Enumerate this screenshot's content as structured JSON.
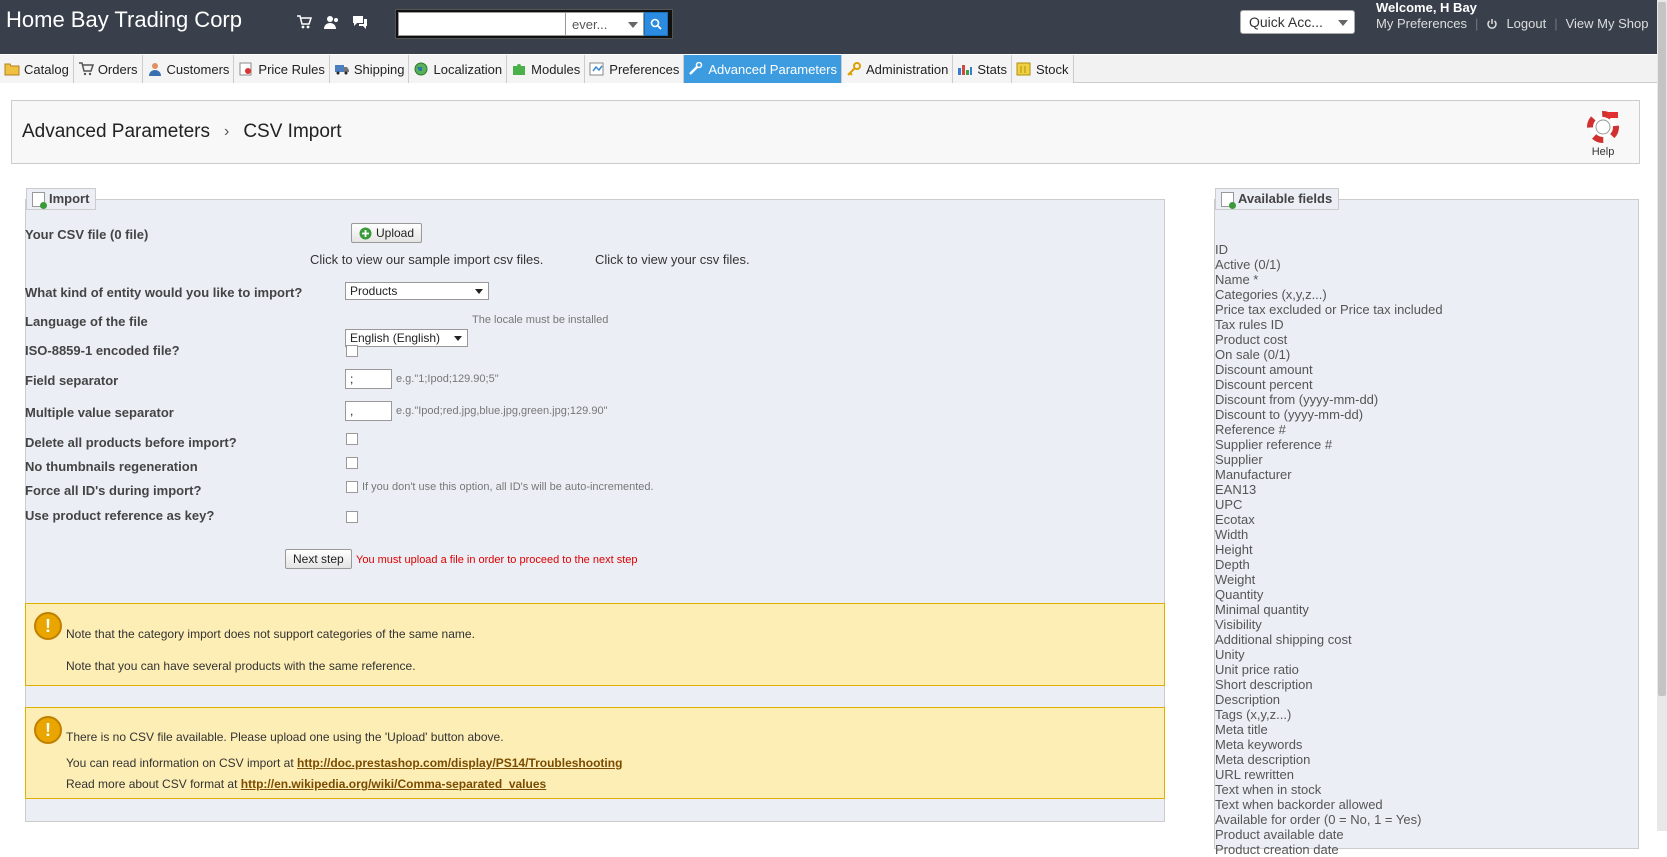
{
  "header": {
    "shop_title": "Home Bay Trading Corp",
    "search_value": "",
    "search_scope": "ever...",
    "quick_access": "Quick Acc...",
    "welcome": "Welcome, H Bay",
    "links": [
      "My Preferences",
      "Logout",
      "View My Shop"
    ]
  },
  "tabs": [
    {
      "label": "Catalog",
      "icon": "folder-icon"
    },
    {
      "label": "Orders",
      "icon": "cart-icon"
    },
    {
      "label": "Customers",
      "icon": "user-icon"
    },
    {
      "label": "Price Rules",
      "icon": "price-tag-icon"
    },
    {
      "label": "Shipping",
      "icon": "truck-icon"
    },
    {
      "label": "Localization",
      "icon": "globe-icon"
    },
    {
      "label": "Modules",
      "icon": "puzzle-icon"
    },
    {
      "label": "Preferences",
      "icon": "preferences-icon"
    },
    {
      "label": "Advanced Parameters",
      "icon": "tools-icon",
      "active": true
    },
    {
      "label": "Administration",
      "icon": "key-icon"
    },
    {
      "label": "Stats",
      "icon": "chart-icon"
    },
    {
      "label": "Stock",
      "icon": "stock-icon"
    }
  ],
  "breadcrumb": [
    "Advanced Parameters",
    "CSV Import"
  ],
  "help_label": "Help",
  "import": {
    "legend": "Import",
    "csv_file_label": "Your CSV file (0 file)",
    "upload_label": "Upload",
    "sample_link": "Click to view our sample import csv files.",
    "your_files_link": "Click to view your csv files.",
    "entity_label": "What kind of entity would you like to import?",
    "entity_value": "Products",
    "language_label": "Language of the file",
    "language_value": "English (English)",
    "language_hint": "The locale must be installed",
    "iso_label": "ISO-8859-1 encoded file?",
    "field_sep_label": "Field separator",
    "field_sep_value": ";",
    "field_sep_hint": "e.g.\"1;Ipod;129.90;5\"",
    "multi_sep_label": "Multiple value separator",
    "multi_sep_value": ",",
    "multi_sep_hint": "e.g.\"Ipod;red.jpg,blue.jpg,green.jpg;129.90\"",
    "delete_label": "Delete all products before import?",
    "thumbs_label": "No thumbnails regeneration",
    "force_ids_label": "Force all ID's during import?",
    "force_ids_hint": "If you don't use this option, all ID's will be auto-incremented.",
    "ref_key_label": "Use product reference as key?",
    "next_label": "Next step",
    "next_warning": "You must upload a file in order to proceed to the next step"
  },
  "notes": {
    "n1_line1": "Note that the category import does not support categories of the same name.",
    "n1_line2": "Note that you can have several products with the same reference.",
    "n2_line1": "There is no CSV file available. Please upload one using the 'Upload' button above.",
    "n2_line2_prefix": "You can read information on CSV import at",
    "n2_line2_link": "http://doc.prestashop.com/display/PS14/Troubleshooting",
    "n2_line3_prefix": "Read more about CSV format at",
    "n2_line3_link": "http://en.wikipedia.org/wiki/Comma-separated_values"
  },
  "available": {
    "legend": "Available fields",
    "fields": [
      "ID",
      "Active (0/1)",
      "Name *",
      "Categories (x,y,z...)",
      "Price tax excluded or Price tax included",
      "Tax rules ID",
      "Product cost",
      "On sale (0/1)",
      "Discount amount",
      "Discount percent",
      "Discount from (yyyy-mm-dd)",
      "Discount to (yyyy-mm-dd)",
      "Reference #",
      "Supplier reference #",
      "Supplier",
      "Manufacturer",
      "EAN13",
      "UPC",
      "Ecotax",
      "Width",
      "Height",
      "Depth",
      "Weight",
      "Quantity",
      "Minimal quantity",
      "Visibility",
      "Additional shipping cost",
      "Unity",
      "Unit price ratio",
      "Short description",
      "Description",
      "Tags (x,y,z...)",
      "Meta title",
      "Meta keywords",
      "Meta description",
      "URL rewritten",
      "Text when in stock",
      "Text when backorder allowed",
      "Available for order (0 = No, 1 = Yes)",
      "Product available date",
      "Product creation date"
    ]
  },
  "colors": {
    "topbar": "#39404b",
    "active_tab": "#3d9ce0",
    "warning_bg": "#fdeeb5",
    "panel_bg": "#ebeef5"
  }
}
